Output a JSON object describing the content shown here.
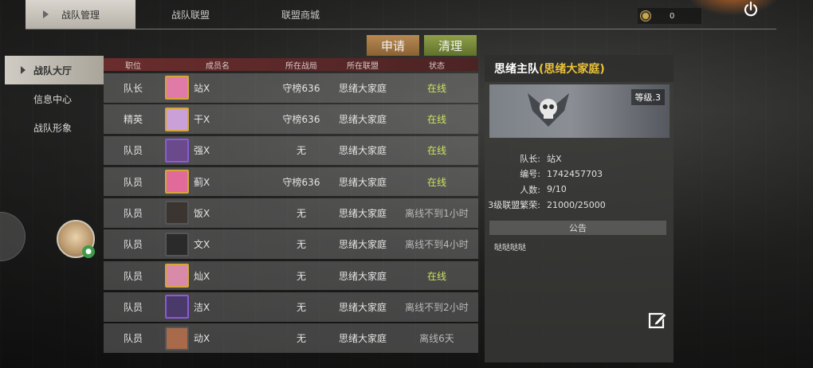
{
  "top_tabs": [
    {
      "label": "战队管理",
      "active": true
    },
    {
      "label": "战队联盟",
      "active": false
    },
    {
      "label": "联盟商城",
      "active": false
    }
  ],
  "currency": {
    "icon": "coin-icon",
    "value": "0"
  },
  "actions": {
    "apply_label": "申请",
    "clean_label": "清理"
  },
  "sidebar": {
    "items": [
      {
        "label": "战队大厅",
        "active": true
      },
      {
        "label": "信息中心",
        "active": false
      },
      {
        "label": "战队形象",
        "active": false
      }
    ]
  },
  "table": {
    "headers": [
      "职位",
      "成员名",
      "所在战局",
      "所在联盟",
      "状态"
    ],
    "rows": [
      {
        "role": "队长",
        "name": "站X",
        "match": "守榜636",
        "alliance": "思绪大家庭",
        "status": "在线",
        "online": true
      },
      {
        "role": "精英",
        "name": "干X",
        "match": "守榜636",
        "alliance": "思绪大家庭",
        "status": "在线",
        "online": true
      },
      {
        "role": "队员",
        "name": "强X",
        "match": "无",
        "alliance": "思绪大家庭",
        "status": "在线",
        "online": true
      },
      {
        "role": "队员",
        "name": "蓟X",
        "match": "守榜636",
        "alliance": "思绪大家庭",
        "status": "在线",
        "online": true
      },
      {
        "role": "队员",
        "name": "饭X",
        "match": "无",
        "alliance": "思绪大家庭",
        "status": "离线不到1小时",
        "online": false
      },
      {
        "role": "队员",
        "name": "文X",
        "match": "无",
        "alliance": "思绪大家庭",
        "status": "离线不到4小时",
        "online": false
      },
      {
        "role": "队员",
        "name": "灿X",
        "match": "无",
        "alliance": "思绪大家庭",
        "status": "在线",
        "online": true
      },
      {
        "role": "队员",
        "name": "洁X",
        "match": "无",
        "alliance": "思绪大家庭",
        "status": "离线不到2小时",
        "online": false
      },
      {
        "role": "队员",
        "name": "动X",
        "match": "无",
        "alliance": "思绪大家庭",
        "status": "离线6天",
        "online": false
      }
    ]
  },
  "team": {
    "title_main": "思绪主队",
    "title_alliance": "(思绪大家庭)",
    "level": "等级.3",
    "info": [
      {
        "key": "队长:",
        "value": "站X"
      },
      {
        "key": "编号:",
        "value": "1742457703"
      },
      {
        "key": "人数:",
        "value": "9/10"
      },
      {
        "key": "3级联盟繁荣:",
        "value": "21000/25000"
      }
    ],
    "notice_label": "公告",
    "notice_text": "哒哒哒哒"
  },
  "colors": {
    "online": "#cfe35a",
    "offline": "#b8b8b8",
    "highlight": "#e9c23a"
  }
}
